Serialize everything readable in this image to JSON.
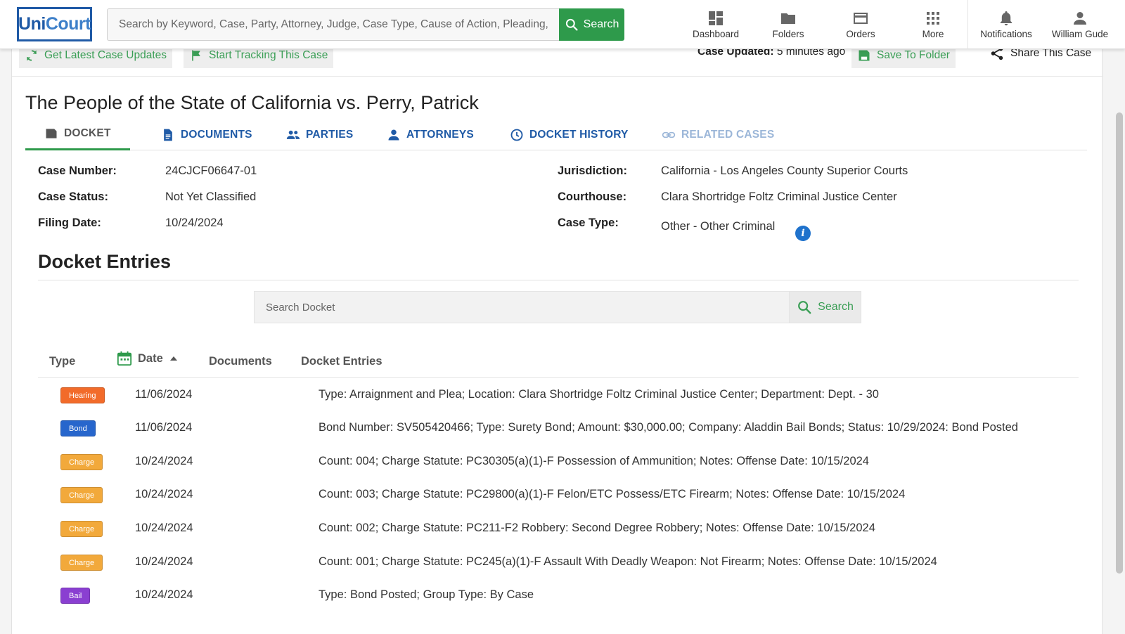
{
  "header": {
    "logo_part1": "Uni",
    "logo_part2": "Court",
    "search_placeholder": "Search by Keyword, Case, Party, Attorney, Judge, Case Type, Cause of Action, Pleading, M",
    "search_button": "Search",
    "nav": [
      {
        "label": "Dashboard",
        "icon": "dashboard-icon"
      },
      {
        "label": "Folders",
        "icon": "folder-icon"
      },
      {
        "label": "Orders",
        "icon": "card-icon"
      },
      {
        "label": "More",
        "icon": "grid-icon"
      },
      {
        "label": "Notifications",
        "icon": "bell-icon"
      },
      {
        "label": "William Gude",
        "icon": "user-icon"
      }
    ]
  },
  "actions": {
    "get_updates": "Get Latest Case Updates",
    "start_tracking": "Start Tracking This Case",
    "updated_label": "Case Updated:",
    "updated_value": "5 minutes ago",
    "save_folder": "Save To Folder",
    "share": "Share This Case"
  },
  "case": {
    "title": "The People of the State of California vs. Perry, Patrick",
    "tabs": [
      {
        "label": "DOCKET",
        "state": "active"
      },
      {
        "label": "DOCUMENTS",
        "state": "normal"
      },
      {
        "label": "PARTIES",
        "state": "normal"
      },
      {
        "label": "ATTORNEYS",
        "state": "normal"
      },
      {
        "label": "DOCKET HISTORY",
        "state": "normal"
      },
      {
        "label": "RELATED CASES",
        "state": "disabled"
      }
    ],
    "info": {
      "case_number_label": "Case Number:",
      "case_number": "24CJCF06647-01",
      "case_status_label": "Case Status:",
      "case_status": "Not Yet Classified",
      "filing_date_label": "Filing Date:",
      "filing_date": "10/24/2024",
      "jurisdiction_label": "Jurisdiction:",
      "jurisdiction": "California - Los Angeles County Superior Courts",
      "courthouse_label": "Courthouse:",
      "courthouse": "Clara Shortridge Foltz Criminal Justice Center",
      "case_type_label": "Case Type:",
      "case_type": "Other - Other Criminal",
      "info_icon": "i"
    }
  },
  "docket": {
    "title": "Docket Entries",
    "search_placeholder": "Search Docket",
    "search_button": "Search",
    "columns": [
      "Type",
      "Date",
      "Documents",
      "Docket Entries"
    ],
    "colors": {
      "Hearing": "#f26b2a",
      "Bond": "#2766cc",
      "Charge": "#f2a93b",
      "Bail": "#8a3fd1"
    },
    "rows": [
      {
        "type": "Hearing",
        "date": "11/06/2024",
        "entry": "Type: Arraignment and Plea; Location: Clara Shortridge Foltz Criminal Justice Center; Department: Dept. - 30"
      },
      {
        "type": "Bond",
        "date": "11/06/2024",
        "entry": "Bond Number: SV505420466; Type: Surety Bond; Amount: $30,000.00; Company: Aladdin Bail Bonds; Status: 10/29/2024: Bond Posted"
      },
      {
        "type": "Charge",
        "date": "10/24/2024",
        "entry": "Count: 004; Charge Statute: PC30305(a)(1)-F Possession of Ammunition; Notes: Offense Date: 10/15/2024"
      },
      {
        "type": "Charge",
        "date": "10/24/2024",
        "entry": "Count: 003; Charge Statute: PC29800(a)(1)-F Felon/ETC Possess/ETC Firearm; Notes: Offense Date: 10/15/2024"
      },
      {
        "type": "Charge",
        "date": "10/24/2024",
        "entry": "Count: 002; Charge Statute: PC211-F2 Robbery: Second Degree Robbery; Notes: Offense Date: 10/15/2024"
      },
      {
        "type": "Charge",
        "date": "10/24/2024",
        "entry": "Count: 001; Charge Statute: PC245(a)(1)-F Assault With Deadly Weapon: Not Firearm; Notes: Offense Date: 10/15/2024"
      },
      {
        "type": "Bail",
        "date": "10/24/2024",
        "entry": "Type: Bond Posted; Group Type: By Case"
      }
    ]
  }
}
